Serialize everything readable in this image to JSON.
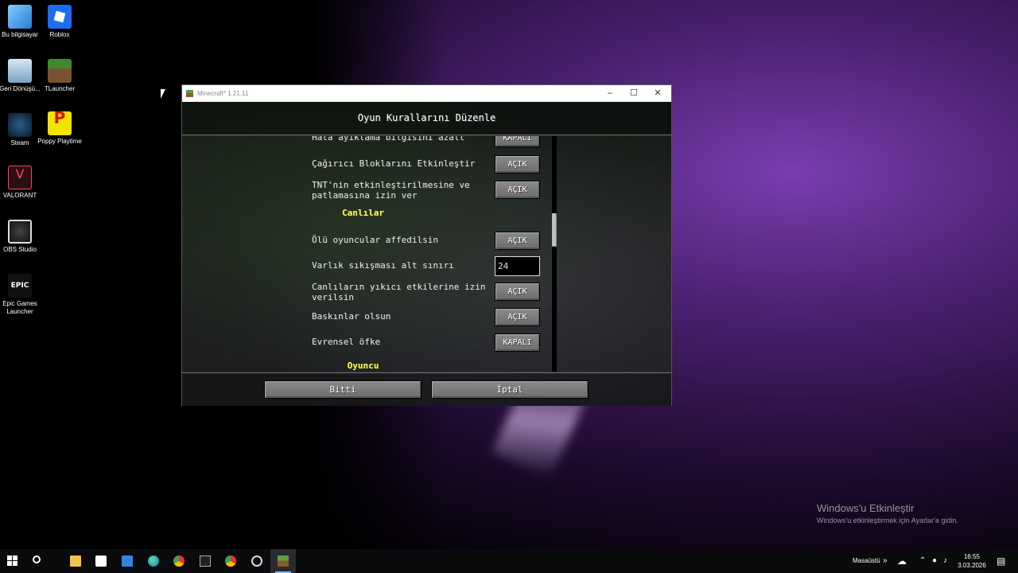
{
  "desktop": {
    "icons": [
      {
        "label": "Bu bilgisayar",
        "icon": "computer-icon"
      },
      {
        "label": "Roblox",
        "icon": "roblox-icon"
      },
      {
        "label": "Geri Dönüşü...",
        "icon": "recycle-bin-icon"
      },
      {
        "label": "TLauncher",
        "icon": "tlauncher-icon"
      },
      {
        "label": "Steam",
        "icon": "steam-icon"
      },
      {
        "label": "Poppy Playtime",
        "icon": "poppy-playtime-icon"
      },
      {
        "label": "VALORANT",
        "icon": "valorant-icon"
      },
      {
        "label": "OBS Studio",
        "icon": "obs-icon"
      },
      {
        "label": "Epic Games Launcher",
        "icon": "epic-games-icon"
      }
    ],
    "epic_logo_text": "EPIC",
    "watermark": {
      "title": "Windows'u Etkinleştir",
      "subtitle": "Windows'u etkinleştirmek için Ayarlar'a gidin."
    }
  },
  "window": {
    "title": "Minecraft* 1.21.11",
    "controls": {
      "minimize": "–",
      "maximize": "☐",
      "close": "✕"
    }
  },
  "screen": {
    "header": "Oyun Kurallarını Düzenle",
    "rows": [
      {
        "label": "Hata ayıklama bilgisini azalt",
        "type": "button",
        "value": "KAPALI"
      },
      {
        "label": "Çağırıcı Bloklarını Etkinleştir",
        "type": "button",
        "value": "AÇIK"
      },
      {
        "label": "TNT'nin etkinleştirilmesine ve patlamasına izin ver",
        "type": "button",
        "value": "AÇIK"
      },
      {
        "label": "Canlılar",
        "type": "section"
      },
      {
        "label": "Ölü oyuncular affedilsin",
        "type": "button",
        "value": "AÇIK"
      },
      {
        "label": "Varlık sıkışması alt sınırı",
        "type": "input",
        "value": "24"
      },
      {
        "label": "Canlıların yıkıcı etkilerine izin verilsin",
        "type": "button",
        "value": "AÇIK"
      },
      {
        "label": "Baskınlar olsun",
        "type": "button",
        "value": "AÇIK"
      },
      {
        "label": "Evrensel öfke",
        "type": "button",
        "value": "KAPALI"
      },
      {
        "label": "Oyuncu",
        "type": "section"
      }
    ],
    "footer": {
      "done": "Bitti",
      "cancel": "İptal"
    },
    "scroll_fraction": 0.33
  },
  "taskbar": {
    "items": [
      "start-icon",
      "search-icon",
      "file-explorer-icon",
      "store-icon",
      "mail-icon",
      "edge-icon",
      "chrome-icon",
      "epic-games-icon",
      "chrome-icon",
      "xbox-icon",
      "minecraft-icon"
    ],
    "tray_label": "Masaüstü",
    "time": "16:55",
    "date": "3.03.2026"
  },
  "colors": {
    "section_title": "#ffff55",
    "button": "#7a7a7a",
    "wallpaper_accent": "#7a3db0"
  }
}
